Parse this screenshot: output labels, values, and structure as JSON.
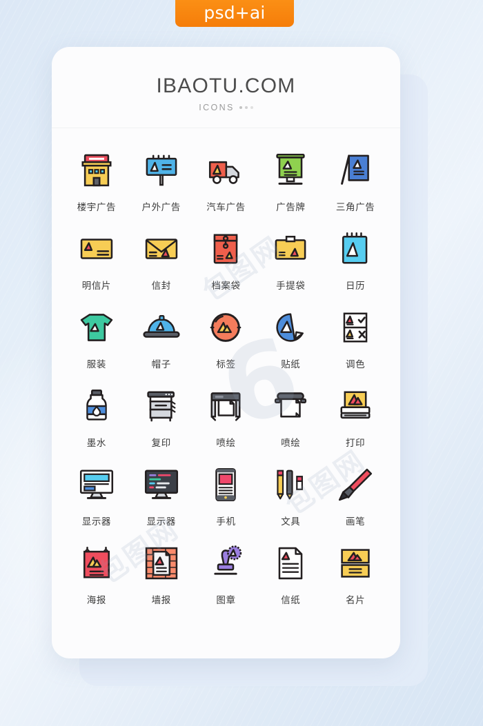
{
  "tag": {
    "label": "psd+ai",
    "color": "#f5820b"
  },
  "header": {
    "brand": "IBAOTU.COM",
    "subtitle": "ICONS",
    "dots_count": 3
  },
  "watermarks": [
    {
      "text": "6",
      "style": "big"
    },
    {
      "text": "包图网",
      "style": "text"
    }
  ],
  "palette": {
    "stroke": "#231f20",
    "yellow": "#f7cd55",
    "blue": "#4fb3e8",
    "red": "#ef5f4c",
    "green": "#8fd14f",
    "royal": "#4a7fd4",
    "teal": "#3dc9a0",
    "cyan": "#57cdf0",
    "steelblue": "#4d8ddb",
    "grey": "#d5d8de",
    "white": "#ffffff",
    "crimson": "#ef4d5e",
    "purple": "#9b7fe0",
    "salmon": "#fa8b6c",
    "pink": "#f0486b",
    "orange": "#f47c5c",
    "darkgrey": "#5a5e66",
    "sheet": "#f4f5f7"
  },
  "icons": [
    {
      "id": "building-ad",
      "label": "楼宇广告",
      "icon": "building"
    },
    {
      "id": "outdoor-ad",
      "label": "户外广告",
      "icon": "billboard"
    },
    {
      "id": "car-ad",
      "label": "汽车广告",
      "icon": "truck"
    },
    {
      "id": "ad-board",
      "label": "广告牌",
      "icon": "standee"
    },
    {
      "id": "triangle-ad",
      "label": "三角广告",
      "icon": "a-frame"
    },
    {
      "id": "postcard",
      "label": "明信片",
      "icon": "postcard"
    },
    {
      "id": "envelope",
      "label": "信封",
      "icon": "envelope"
    },
    {
      "id": "file-bag",
      "label": "档案袋",
      "icon": "filebag"
    },
    {
      "id": "handbag",
      "label": "手提袋",
      "icon": "box"
    },
    {
      "id": "calendar",
      "label": "日历",
      "icon": "calendar"
    },
    {
      "id": "clothing",
      "label": "服装",
      "icon": "tshirt"
    },
    {
      "id": "hat",
      "label": "帽子",
      "icon": "cap"
    },
    {
      "id": "label-tag",
      "label": "标签",
      "icon": "circle-badge"
    },
    {
      "id": "sticker",
      "label": "贴纸",
      "icon": "sticker"
    },
    {
      "id": "color-adjust",
      "label": "调色",
      "icon": "proof"
    },
    {
      "id": "ink",
      "label": "墨水",
      "icon": "inkbottle"
    },
    {
      "id": "copier",
      "label": "复印",
      "icon": "copier"
    },
    {
      "id": "inkjet-1",
      "label": "喷绘",
      "icon": "plotter"
    },
    {
      "id": "inkjet-2",
      "label": "喷绘",
      "icon": "plotter2"
    },
    {
      "id": "print",
      "label": "打印",
      "icon": "printer"
    },
    {
      "id": "monitor-light",
      "label": "显示器",
      "icon": "monitor-light"
    },
    {
      "id": "monitor-dark",
      "label": "显示器",
      "icon": "monitor-dark"
    },
    {
      "id": "phone",
      "label": "手机",
      "icon": "phone"
    },
    {
      "id": "stationery",
      "label": "文具",
      "icon": "stationery"
    },
    {
      "id": "brush",
      "label": "画笔",
      "icon": "brush"
    },
    {
      "id": "poster",
      "label": "海报",
      "icon": "poster"
    },
    {
      "id": "wall-poster",
      "label": "墙报",
      "icon": "wallposter"
    },
    {
      "id": "stamp",
      "label": "图章",
      "icon": "stamp"
    },
    {
      "id": "letter-paper",
      "label": "信纸",
      "icon": "letterpaper"
    },
    {
      "id": "name-card",
      "label": "名片",
      "icon": "namecard"
    }
  ]
}
